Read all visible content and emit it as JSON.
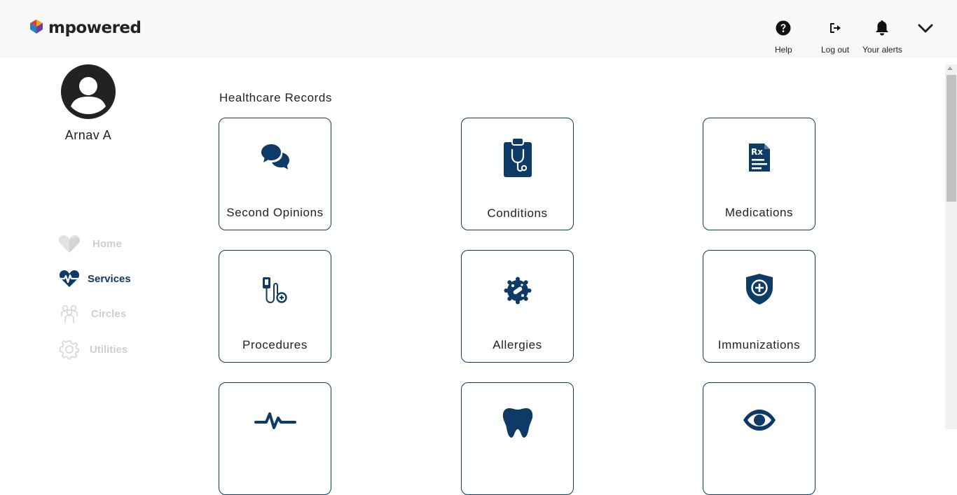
{
  "header": {
    "brand": "mpowered",
    "help_label": "Help",
    "logout_label": "Log out",
    "alerts_label": "Your alerts"
  },
  "user": {
    "name": "Arnav A"
  },
  "sidebar": {
    "items": [
      {
        "label": "Home",
        "icon": "heart-home-icon",
        "active": false
      },
      {
        "label": "Services",
        "icon": "heartbeat-icon",
        "active": true
      },
      {
        "label": "Circles",
        "icon": "people-icon",
        "active": false
      },
      {
        "label": "Utilities",
        "icon": "gear-icon",
        "active": false
      }
    ]
  },
  "main": {
    "section_title": "Healthcare Records",
    "cards": [
      {
        "label": "Second Opinions",
        "icon": "chat-bubbles-icon"
      },
      {
        "label": "Conditions",
        "icon": "clipboard-stethoscope-icon"
      },
      {
        "label": "Medications",
        "icon": "prescription-icon"
      },
      {
        "label": "Procedures",
        "icon": "iv-drip-icon"
      },
      {
        "label": "Allergies",
        "icon": "allergen-icon"
      },
      {
        "label": "Immunizations",
        "icon": "shield-plus-icon"
      },
      {
        "label": "",
        "icon": "pulse-icon"
      },
      {
        "label": "",
        "icon": "tooth-icon"
      },
      {
        "label": "",
        "icon": "eye-icon"
      }
    ]
  },
  "colors": {
    "primary": "#0d3b66",
    "muted": "#cfcfcf",
    "header_bg": "#f8f8f8"
  }
}
